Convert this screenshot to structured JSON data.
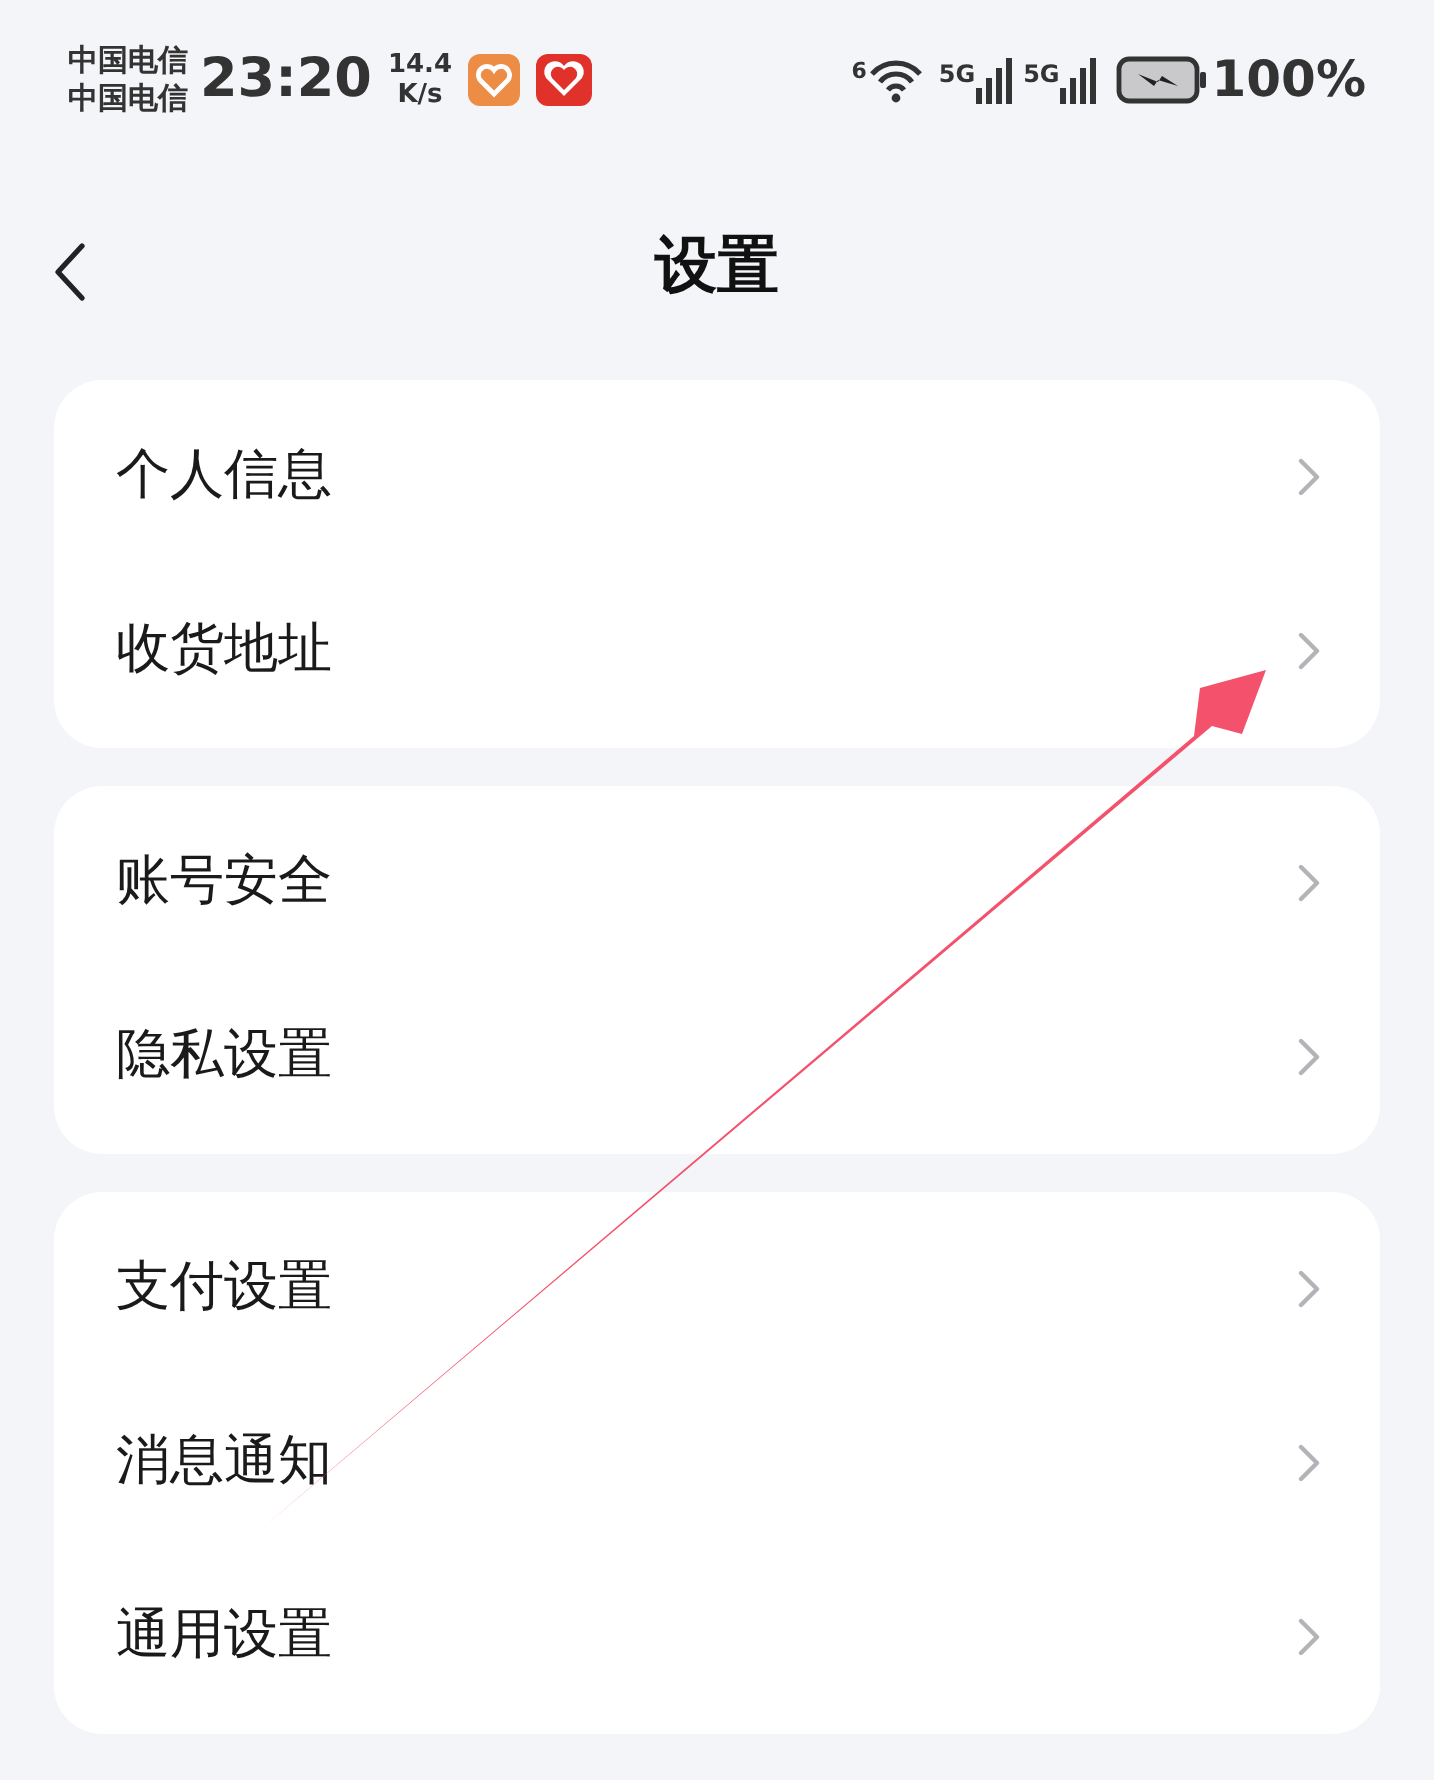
{
  "status_bar": {
    "carriers": [
      "中国电信",
      "中国电信"
    ],
    "time": "23:20",
    "speed": [
      "14.4",
      "K/s"
    ],
    "wifi_label": "6",
    "signals": [
      "5G",
      "5G"
    ],
    "battery": "100%"
  },
  "header": {
    "title": "设置"
  },
  "groups": [
    {
      "items": [
        {
          "label": "个人信息"
        },
        {
          "label": "收货地址"
        }
      ]
    },
    {
      "items": [
        {
          "label": "账号安全"
        },
        {
          "label": "隐私设置"
        }
      ]
    },
    {
      "items": [
        {
          "label": "支付设置"
        },
        {
          "label": "消息通知"
        },
        {
          "label": "通用设置"
        }
      ]
    }
  ],
  "annotation": {
    "kind": "arrow"
  }
}
